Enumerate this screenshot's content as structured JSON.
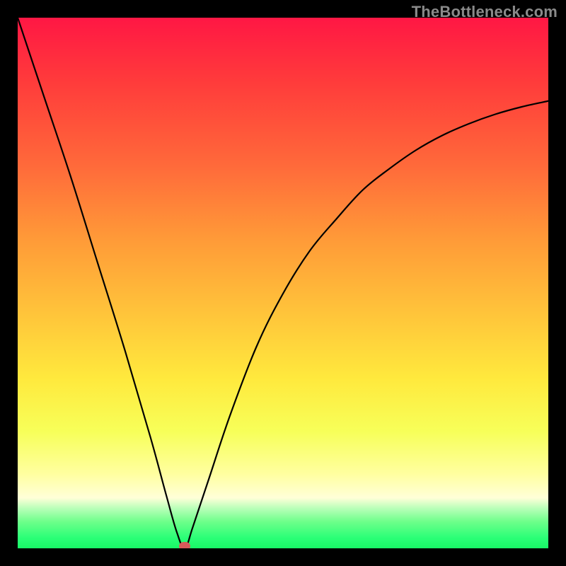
{
  "watermark": "TheBottleneck.com",
  "colors": {
    "frame": "#000000",
    "curve": "#000000",
    "marker": "#d65a5a"
  },
  "chart_data": {
    "type": "line",
    "title": "",
    "xlabel": "",
    "ylabel": "",
    "xlim": [
      0,
      100
    ],
    "ylim": [
      0,
      100
    ],
    "grid": false,
    "legend": false,
    "notes": "V-shaped bottleneck curve over a red-to-green vertical gradient. x is a normalized horizontal parameter (0=left, 100=right). y is bottleneck percentage (0=bottom/green, 100=top/red). Minimum at x≈31.5, y≈0. Values are estimated from pixels.",
    "series": [
      {
        "name": "bottleneck",
        "x": [
          0,
          5,
          10,
          15,
          20,
          25,
          28,
          30,
          31.5,
          33,
          36,
          40,
          45,
          50,
          55,
          60,
          65,
          70,
          75,
          80,
          85,
          90,
          95,
          100
        ],
        "y": [
          100,
          85,
          70,
          54,
          38,
          21,
          10,
          3,
          0,
          4,
          13,
          25,
          38,
          48,
          56,
          62,
          67.5,
          71.5,
          75,
          77.8,
          80,
          81.8,
          83.2,
          84.3
        ]
      }
    ],
    "marker": {
      "x": 31.5,
      "y": 0
    }
  }
}
